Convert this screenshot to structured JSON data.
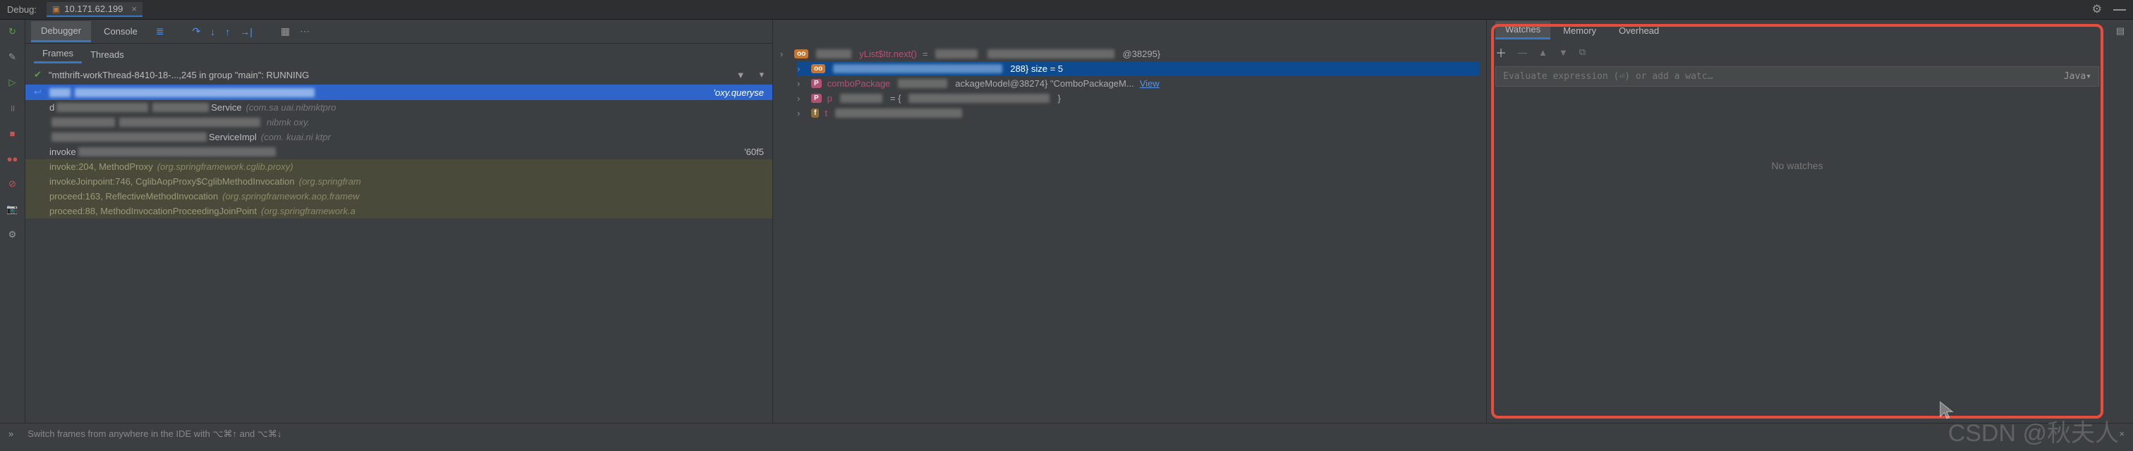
{
  "topbar": {
    "debug_label": "Debug:",
    "run_config": "10.171.62.199"
  },
  "debugger": {
    "tabs": {
      "debugger": "Debugger",
      "console": "Console"
    },
    "sub_tabs": {
      "frames": "Frames",
      "threads": "Threads"
    },
    "thread_status": "\"mtthrift-workThread-8410-18-...,245 in group \"main\": RUNNING",
    "stack": [
      {
        "text_right": "'oxy.queryse",
        "selected": true
      },
      {
        "mid": "Service",
        "pkg": "(com.sa       uai.nibmktpro"
      },
      {
        "pkg": "       nibmk      oxy."
      },
      {
        "mid": "ServiceImpl",
        "pkg": "(com.      kuai.ni      ktpr"
      },
      {
        "left": "invoke",
        "right": "'60f5"
      },
      {
        "left": "invoke:204, MethodProxy",
        "pkg": "(org.springframework.cglib.proxy)"
      },
      {
        "left": "invokeJoinpoint:746, CglibAopProxy$CglibMethodInvocation",
        "pkg": "(org.springfram"
      },
      {
        "left": "proceed:163, ReflectiveMethodInvocation",
        "pkg": "(org.springframework.aop.framew"
      },
      {
        "left": "proceed:88, MethodInvocationProceedingJoinPoint",
        "pkg": "(org.springframework.a"
      }
    ]
  },
  "variables": {
    "rows": [
      {
        "chev": true,
        "tag": "oo",
        "tagClass": "tag-o",
        "name_partial": "yList$Itr.next()",
        "eq": "=",
        "val_partial": "@38295}"
      },
      {
        "chev": true,
        "tag": "oo",
        "tagClass": "tag-o",
        "val": "288}  size = 5",
        "selected": true
      },
      {
        "chev": true,
        "tag": "P",
        "tagClass": "tag-p",
        "name": "comboPackage",
        "val": "ackageModel@38274} \"ComboPackageM...",
        "view": "View"
      },
      {
        "chev": true,
        "tag": "P",
        "tagClass": "tag-p",
        "name_blur": true
      },
      {
        "chev": true,
        "tag": "f",
        "tagClass": "tag-f",
        "name_blur": true
      }
    ]
  },
  "watches": {
    "tabs": {
      "watches": "Watches",
      "memory": "Memory",
      "overhead": "Overhead"
    },
    "placeholder": "Evaluate expression (⏎) or add a watc…",
    "lang": "Java▾",
    "empty": "No watches"
  },
  "bottom": {
    "hint": "Switch frames from anywhere in the IDE with ⌥⌘↑ and ⌥⌘↓"
  },
  "watermark": "CSDN @秋夫人"
}
